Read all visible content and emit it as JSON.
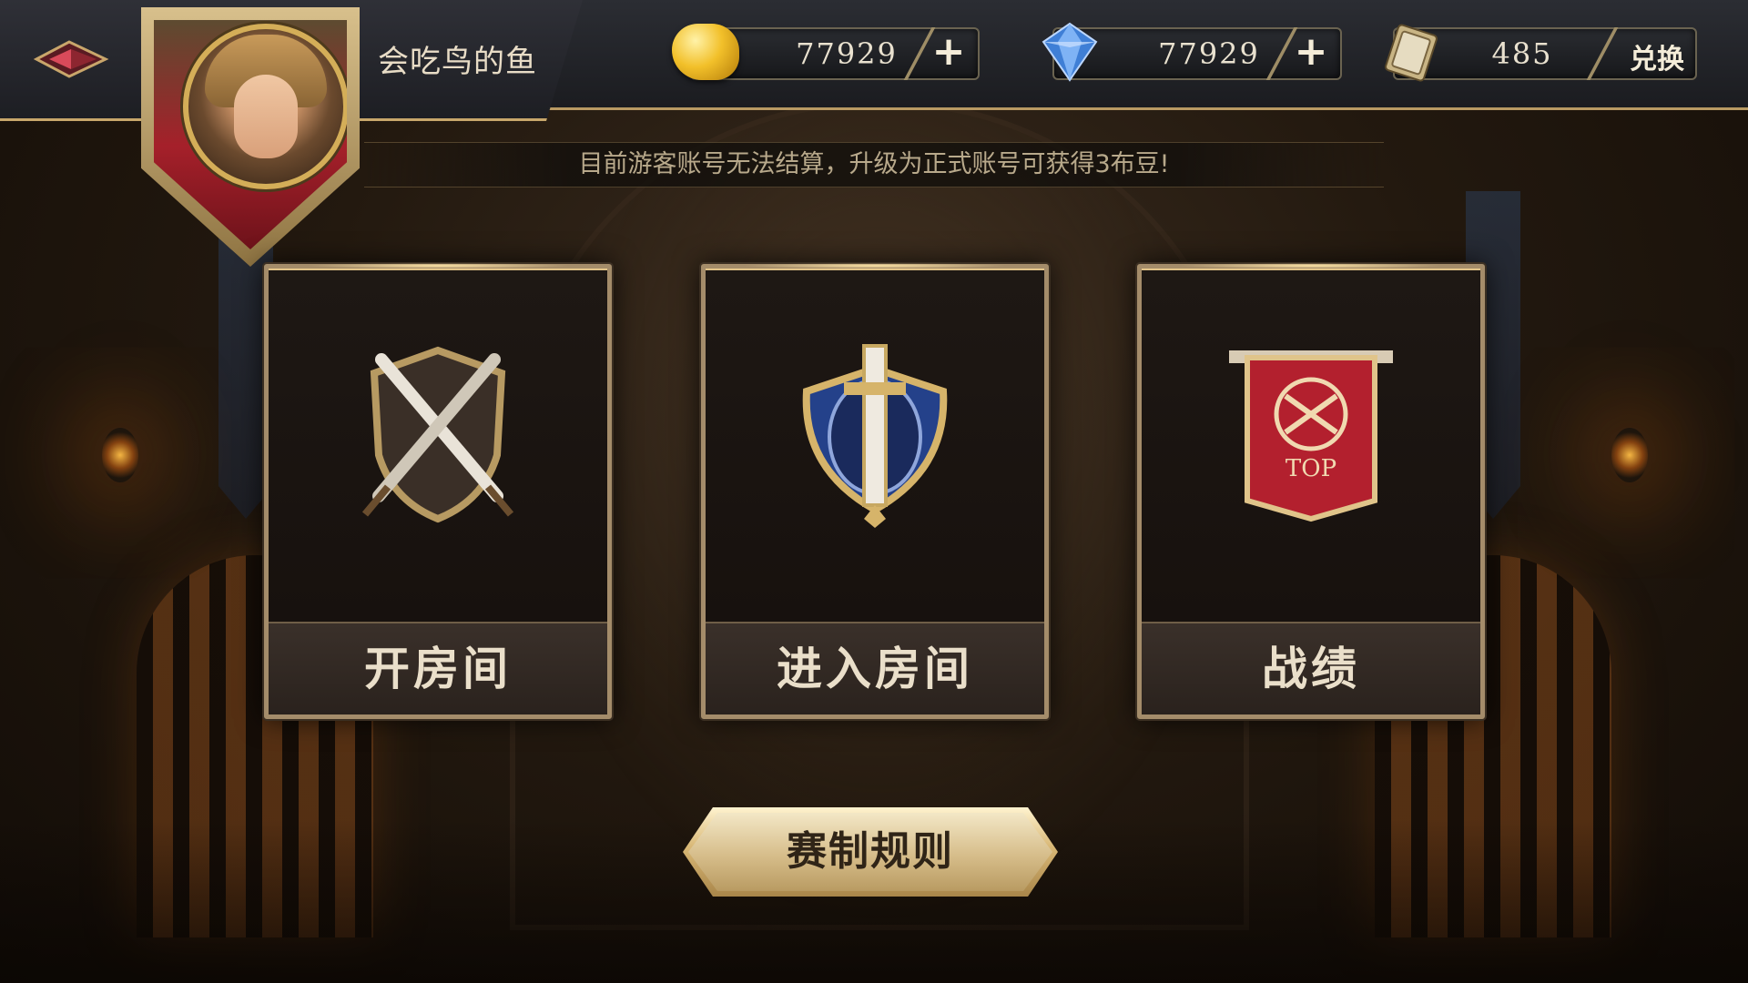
{
  "player": {
    "name": "会吃鸟的鱼"
  },
  "currencies": [
    {
      "icon": "gold-bean-icon",
      "amount": "77929",
      "action": "+"
    },
    {
      "icon": "blue-diamond-icon",
      "amount": "77929",
      "action": "+"
    },
    {
      "icon": "card-ticket-icon",
      "amount": "485",
      "action": "兑换"
    }
  ],
  "notice": "目前游客账号无法结算，升级为正式账号可获得3布豆!",
  "menu": {
    "create_room": "开房间",
    "join_room": "进入房间",
    "records": "战绩",
    "records_badge": "TOP"
  },
  "rules_button": "赛制规则",
  "colors": {
    "gold_trim": "#c8a76b",
    "banner_red": "#a5202a",
    "card_text": "#eadfca"
  }
}
